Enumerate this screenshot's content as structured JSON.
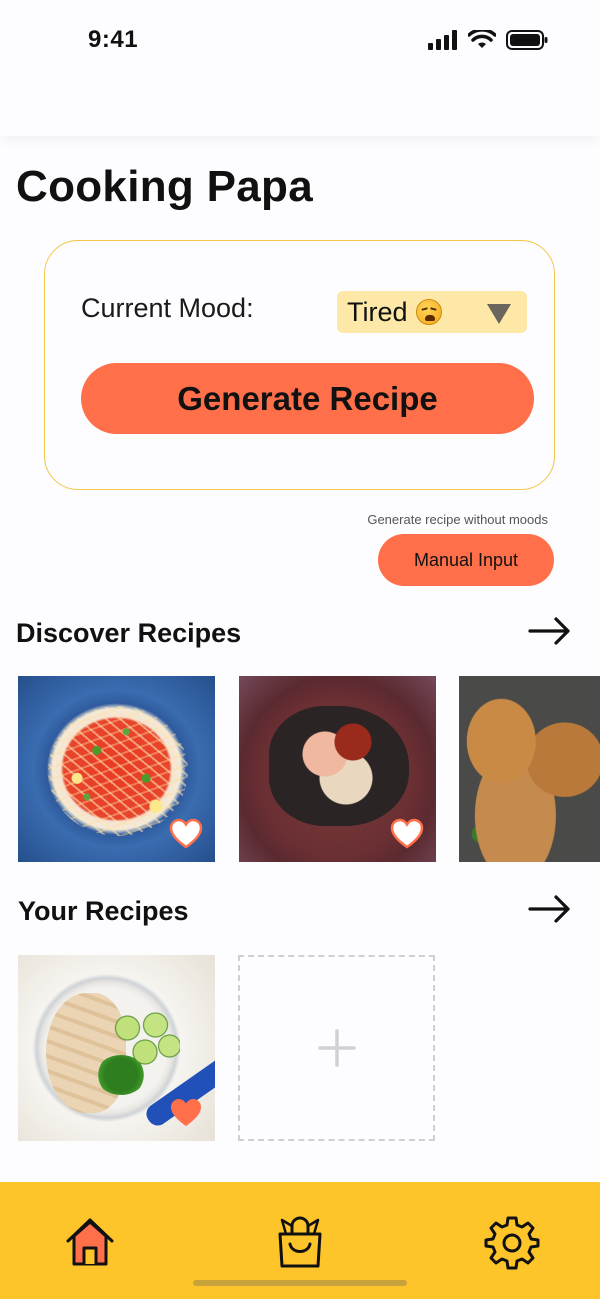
{
  "status_bar": {
    "time": "9:41"
  },
  "app": {
    "title": "Cooking Papa"
  },
  "mood": {
    "label": "Current Mood:",
    "selected": "Tired",
    "emoji_name": "weary-face-icon"
  },
  "actions": {
    "generate_label": "Generate Recipe",
    "manual_hint": "Generate recipe without moods",
    "manual_label": "Manual Input"
  },
  "discover": {
    "title": "Discover Recipes",
    "items": [
      {
        "name": "tomato-noodle-soup",
        "favorited": false
      },
      {
        "name": "stuffed-eggplant",
        "favorited": false
      },
      {
        "name": "roasted-chicken-wings",
        "favorited": false
      }
    ]
  },
  "yours": {
    "title": "Your Recipes",
    "items": [
      {
        "name": "hainanese-chicken-rice",
        "favorited": true
      }
    ]
  },
  "nav": {
    "items": [
      "home-icon",
      "shopping-bag-icon",
      "gear-icon"
    ],
    "active": "home-icon"
  },
  "colors": {
    "accent": "#ff6f4a",
    "nav_bg": "#fdc52a",
    "select_bg": "#fde8a8",
    "card_border": "#f2c74a"
  }
}
